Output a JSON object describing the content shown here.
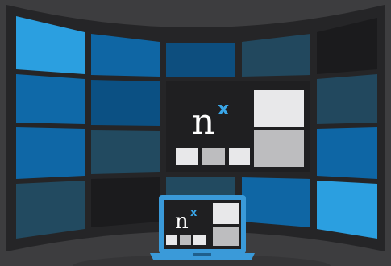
{
  "logo": {
    "n": "n",
    "x": "x"
  },
  "laptop_logo": {
    "n": "n",
    "x": "x"
  },
  "colors": {
    "background": "#3d3d3f",
    "frame": "#262628",
    "accent": "#3aa6e8",
    "tile_light_blue": "#2a9ee0",
    "tile_mid_blue": "#0f6aa8",
    "tile_dark_blue": "#0d4f7f",
    "tile_slate": "#224a60",
    "tile_black": "#1a1a1c",
    "laptop": "#3a9ad9"
  }
}
